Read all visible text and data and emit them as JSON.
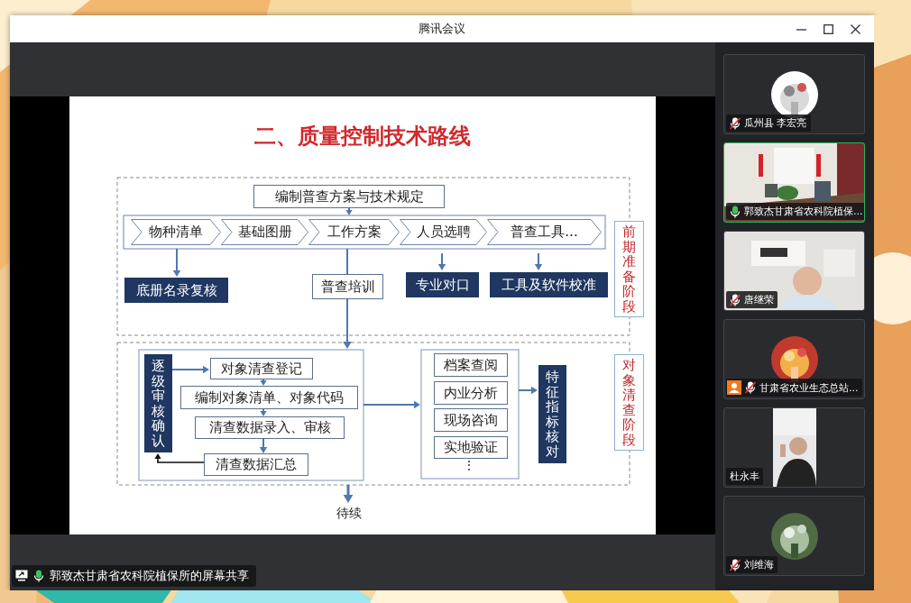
{
  "window": {
    "title": "腾讯会议"
  },
  "slide": {
    "title": "二、质量控制技术路线",
    "nodes": [
      {
        "kind": "box",
        "text": "编制普查方案与技术规定"
      },
      {
        "kind": "chevron",
        "text": "物种清单"
      },
      {
        "kind": "chevron",
        "text": "基础图册"
      },
      {
        "kind": "chevron",
        "text": "工作方案"
      },
      {
        "kind": "chevron",
        "text": "人员选聘"
      },
      {
        "kind": "chevron",
        "text": "普查工具..."
      },
      {
        "kind": "stage",
        "text": "前期准备阶段"
      },
      {
        "kind": "filled",
        "text": "底册名录复核"
      },
      {
        "kind": "box",
        "text": "普查培训"
      },
      {
        "kind": "filled",
        "text": "专业对口"
      },
      {
        "kind": "filled",
        "text": "工具及软件校准"
      },
      {
        "kind": "vfilled",
        "text": "逐级审核确认"
      },
      {
        "kind": "box",
        "text": "对象清查登记"
      },
      {
        "kind": "box",
        "text": "编制对象清单、对象代码"
      },
      {
        "kind": "box",
        "text": "清查数据录入、审核"
      },
      {
        "kind": "box",
        "text": "清查数据汇总"
      },
      {
        "kind": "box",
        "text": "档案查阅"
      },
      {
        "kind": "box",
        "text": "内业分析"
      },
      {
        "kind": "box",
        "text": "现场咨询"
      },
      {
        "kind": "box",
        "text": "实地验证"
      },
      {
        "kind": "text",
        "text": "⋮"
      },
      {
        "kind": "vfilled",
        "text": "特征指标核对"
      },
      {
        "kind": "stage",
        "text": "对象清查阶段"
      },
      {
        "kind": "text",
        "text": "待续"
      }
    ]
  },
  "share_label": {
    "text": "郭致杰甘肃省农科院植保所的屏幕共享",
    "muted": false
  },
  "participants": [
    {
      "name": "瓜州县 李宏亮",
      "kind": "avatar",
      "mic_icon": true,
      "muted": true,
      "speaking": false,
      "host": false
    },
    {
      "name": "郭致杰甘肃省农科院植保...",
      "kind": "video",
      "mic_icon": true,
      "muted": false,
      "speaking": true,
      "host": false
    },
    {
      "name": "唐继荣",
      "kind": "video",
      "mic_icon": true,
      "muted": true,
      "speaking": false,
      "host": false
    },
    {
      "name": "甘肃省农业生态总站...",
      "kind": "avatar",
      "mic_icon": true,
      "muted": true,
      "speaking": false,
      "host": true
    },
    {
      "name": "杜永丰",
      "kind": "portrait",
      "mic_icon": false,
      "speaking": false,
      "host": false
    },
    {
      "name": "刘维海",
      "kind": "avatar",
      "mic_icon": true,
      "muted": true,
      "speaking": false,
      "host": false
    }
  ]
}
